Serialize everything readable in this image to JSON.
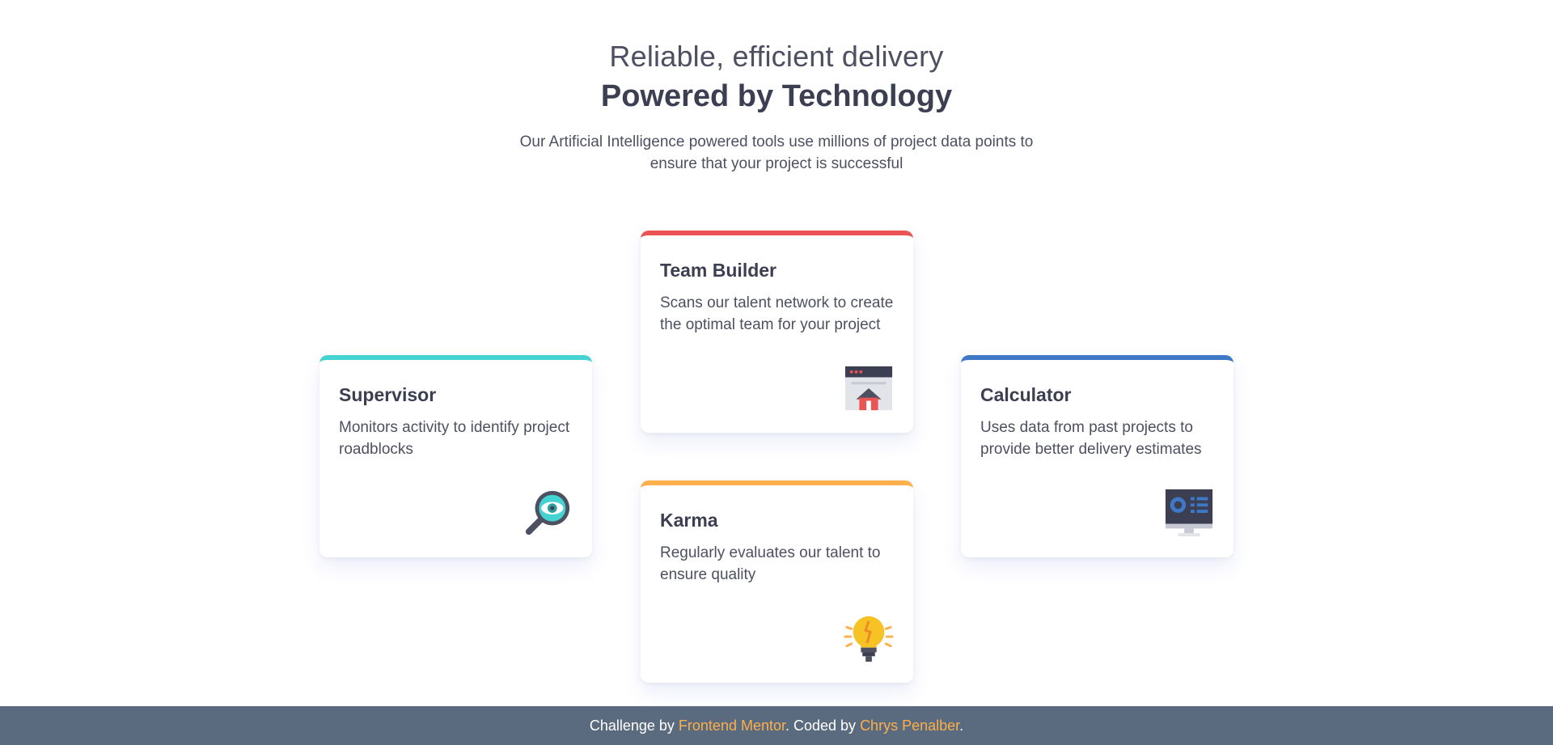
{
  "header": {
    "subtitle": "Reliable, efficient delivery",
    "title": "Powered by Technology",
    "description": "Our Artificial Intelligence powered tools use millions of project data points to ensure that your project is successful"
  },
  "cards": [
    {
      "title": "Supervisor",
      "text": "Monitors activity to identify project roadblocks",
      "icon": "magnifier-eye-icon",
      "accent": "#44d3d2"
    },
    {
      "title": "Team Builder",
      "text": "Scans our talent network to create the optimal team for your project",
      "icon": "team-builder-window-icon",
      "accent": "#ea5454"
    },
    {
      "title": "Karma",
      "text": "Regularly evaluates our talent to ensure quality",
      "icon": "lightbulb-icon",
      "accent": "#fcaf4a"
    },
    {
      "title": "Calculator",
      "text": "Uses data from past projects to provide better delivery estimates",
      "icon": "calculator-monitor-icon",
      "accent": "#3e78c7"
    }
  ],
  "footer": {
    "prefix": "Challenge by ",
    "challenge_link": "Frontend Mentor",
    "middle": ". Coded by ",
    "author_link": "Chrys Penalber",
    "suffix": "."
  }
}
